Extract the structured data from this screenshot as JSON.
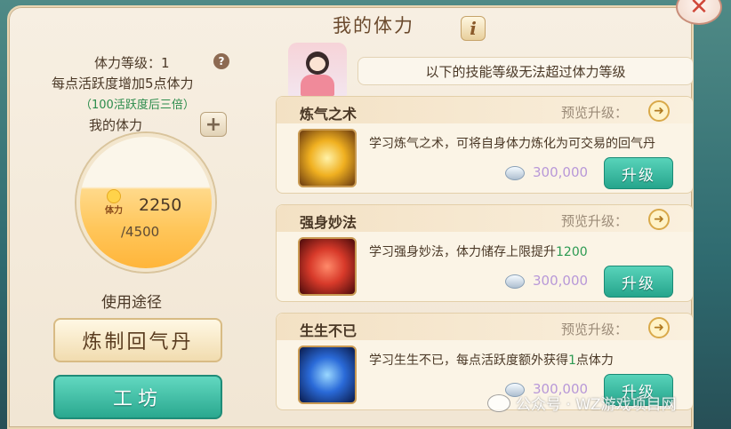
{
  "title": "我的体力",
  "stamina": {
    "level_label": "体力等级：1",
    "per_point": "每点活跃度增加5点体力",
    "triple_note": "（100活跃度后三倍）",
    "orb_label": "我的体力",
    "orb_icon_text": "体力",
    "current": "2250",
    "max": "/4500"
  },
  "usage": {
    "title": "使用途径",
    "refine_button": "炼制回气丹",
    "workshop_button": "工坊"
  },
  "notice": "以下的技能等级无法超过体力等级",
  "skills": [
    {
      "name": "炼气之术",
      "preview": "预览升级：",
      "desc": "学习炼气之术，可将自身体力炼化为可交易的回气丹",
      "desc_highlight": "",
      "cost": "300,000",
      "button": "升级",
      "icon_color": "#f0b020"
    },
    {
      "name": "强身妙法",
      "preview": "预览升级：",
      "desc": "学习强身妙法，体力储存上限提升",
      "desc_highlight": "1200",
      "cost": "300,000",
      "button": "升级",
      "icon_color": "#d83a2a"
    },
    {
      "name": "生生不已",
      "preview": "预览升级：",
      "desc": "学习生生不已，每点活跃度额外获得",
      "desc_highlight": "1",
      "desc_tail": "点体力",
      "cost": "300,000",
      "button": "升级",
      "icon_color": "#2a6ad8"
    }
  ],
  "watermark": "公众号 · WZ游戏项目网"
}
